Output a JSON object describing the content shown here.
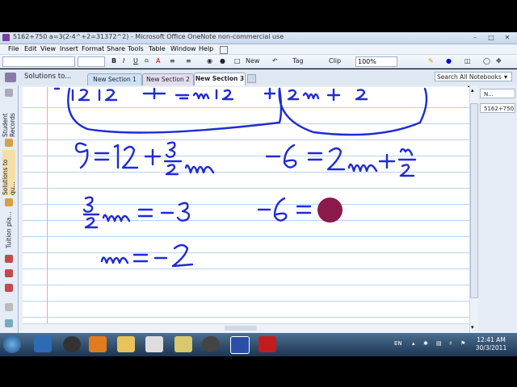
{
  "window": {
    "title": "5162+750 a=3(2-4^+2=31372^2) - Microsoft Office OneNote non-commercial use"
  },
  "menu": [
    "File",
    "Edit",
    "View",
    "Insert",
    "Format",
    "Share",
    "Tools",
    "Table",
    "Window",
    "Help"
  ],
  "toolbar": {
    "new_label": "New",
    "tag_label": "Tag",
    "clip_label": "Clip",
    "zoom": "100%"
  },
  "notebook": {
    "title": "Solutions to...",
    "sections": [
      "New Section 1",
      "New Section 2",
      "New Section 3"
    ],
    "active_section": "New Section 3"
  },
  "search": {
    "placeholder": "Search All Notebooks"
  },
  "sidebar": {
    "items": [
      "Student Records",
      "Solutions to qu...",
      "Tuition pla..."
    ]
  },
  "pages_panel": {
    "new_page": "N...",
    "pages": [
      "5162+750"
    ]
  },
  "ink": {
    "eq1": "9 = 12 + 3/2 m",
    "eq2": "3/2 m = -3",
    "eq3": "m = -2",
    "eq4": "-6 = 2m + n/2",
    "eq5": "-6 =",
    "ink_color": "#1f2bd4",
    "cursor_color": "#8b1a4c"
  },
  "taskbar": {
    "lang": "EN",
    "time": "12:41 AM",
    "date": "30/3/2011"
  }
}
